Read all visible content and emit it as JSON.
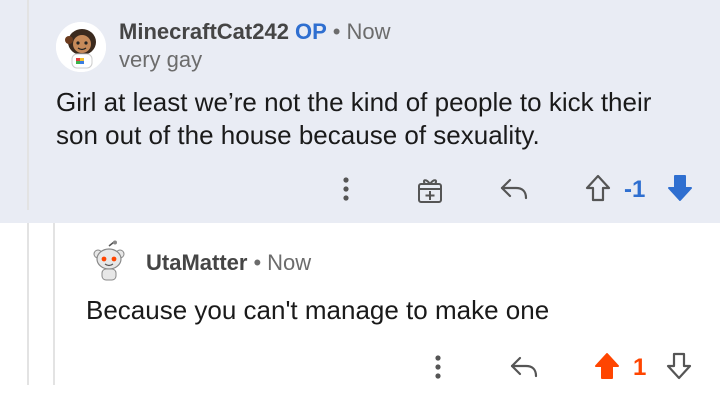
{
  "comments": [
    {
      "author": "MinecraftCat242",
      "op_badge": "OP",
      "separator": "•",
      "time": "Now",
      "flair": "very gay",
      "text": "Girl at least we’re not the kind of people to kick their son out of the house because of sexuality.",
      "score": "-1",
      "vote_state": "downvoted",
      "accent": "#2f6fd0",
      "background": "#e9ecf4",
      "icons": [
        "more-icon",
        "gift-award-icon",
        "reply-icon",
        "upvote-icon",
        "downvote-icon"
      ]
    },
    {
      "author": "UtaMatter",
      "separator": "•",
      "time": "Now",
      "text": "Because you can't manage to make one",
      "score": "1",
      "vote_state": "upvoted",
      "accent": "#ff4500",
      "icons": [
        "more-icon",
        "reply-icon",
        "upvote-icon",
        "downvote-icon"
      ]
    }
  ]
}
